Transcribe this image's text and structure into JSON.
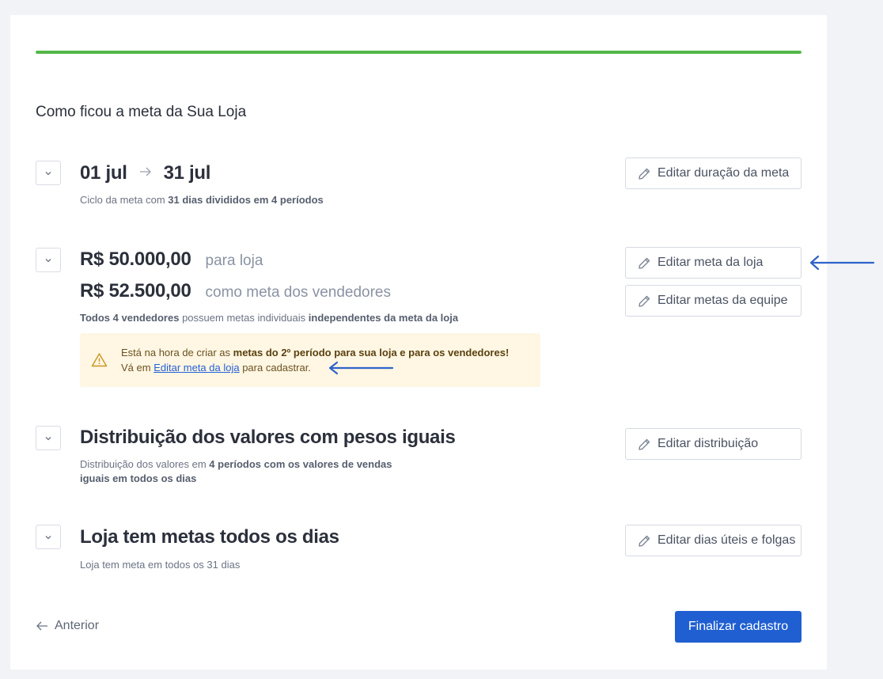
{
  "progress": {
    "percent": 100,
    "color": "#52b848"
  },
  "page_title": "Como ficou a meta da Sua Loja",
  "duration": {
    "start": "01 jul",
    "end": "31 jul",
    "desc_prefix": "Ciclo da meta com ",
    "desc_bold": "31 dias divididos em 4 períodos",
    "edit_label": "Editar duração da meta"
  },
  "goals": {
    "store_value": "R$ 50.000,00",
    "store_label": "para loja",
    "sellers_value": "R$ 52.500,00",
    "sellers_label": "como meta dos vendedores",
    "desc_bold1": "Todos 4 vendedores",
    "desc_mid": " possuem metas individuais ",
    "desc_bold2": "independentes da meta da loja",
    "edit_store_label": "Editar meta da loja",
    "edit_team_label": "Editar metas da equipe"
  },
  "alert": {
    "line1_prefix": "Está na hora de criar as ",
    "line1_bold": "metas do 2º período para sua loja e para os vendedores!",
    "line2_prefix": "Vá em ",
    "line2_link": "Editar meta da loja",
    "line2_suffix": " para cadastrar."
  },
  "distribution": {
    "title": "Distribuição dos valores com pesos iguais",
    "desc_prefix": "Distribuição dos valores em ",
    "desc_bold1": "4 períodos com os valores de vendas",
    "desc_bold2": "iguais em todos os dias",
    "edit_label": "Editar distribuição"
  },
  "days": {
    "title": "Loja tem metas todos os dias",
    "desc": "Loja tem meta em todos os 31 dias",
    "edit_label": "Editar dias úteis e folgas"
  },
  "footer": {
    "prev_label": "Anterior",
    "finish_label": "Finalizar cadastro"
  },
  "colors": {
    "primary": "#1f5fd1",
    "annotation_arrow": "#2f63c9",
    "alert_bg": "#fff6e3"
  }
}
